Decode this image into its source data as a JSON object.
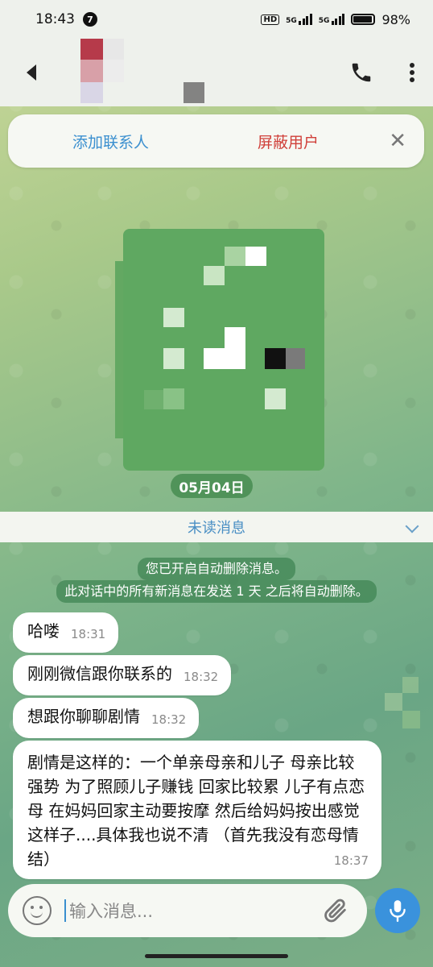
{
  "status_bar": {
    "time": "18:43",
    "notification_count": "7",
    "hd": "HD",
    "signal1_label": "5G",
    "signal2_label": "5G",
    "battery": "98%"
  },
  "contact_bar": {
    "add_contact": "添加联系人",
    "block_user": "屏蔽用户",
    "close": "✕"
  },
  "date_pill": "05月04日",
  "unread_label": "未读消息",
  "system_message": {
    "line1": "您已开启自动删除消息。",
    "line2": "此对话中的所有新消息在发送 1 天 之后将自动删除。"
  },
  "messages": [
    {
      "text": "哈喽",
      "time": "18:31"
    },
    {
      "text": "刚刚微信跟你联系的",
      "time": "18:32"
    },
    {
      "text": "想跟你聊聊剧情",
      "time": "18:32"
    },
    {
      "text": "剧情是这样的：一个单亲母亲和儿子 母亲比较强势 为了照顾儿子赚钱 回家比较累 儿子有点恋母 在妈妈回家主动要按摩 然后给妈妈按出感觉这样子....具体我也说不清 （首先我没有恋母情结）",
      "time": "18:37"
    }
  ],
  "input": {
    "placeholder": "输入消息..."
  },
  "colors": {
    "accent": "#3a92dc",
    "link_blue": "#3a8fcf",
    "danger_red": "#d0403a"
  }
}
